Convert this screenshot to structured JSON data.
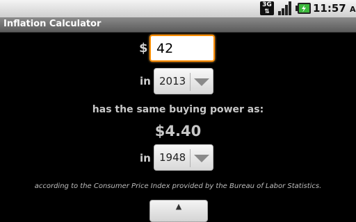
{
  "status_bar": {
    "network_type": "3G",
    "clock": "11:57",
    "clock_suffix": "AM",
    "icons": [
      "3g-icon",
      "signal-icon",
      "battery-icon"
    ]
  },
  "app": {
    "title": "Inflation Calculator"
  },
  "calculator": {
    "currency_symbol": "$",
    "amount_value": "42",
    "in_label_1": "in",
    "from_year": "2013",
    "same_power_text": "has the same buying power as:",
    "result": "$4.40",
    "in_label_2": "in",
    "to_year": "1948",
    "footnote": "according to the Consumer Price Index provided by the Bureau of Labor Statistics.",
    "bottom_button_label": "▲"
  },
  "colors": {
    "input_focus": "#ff8c00",
    "background": "#000000"
  }
}
